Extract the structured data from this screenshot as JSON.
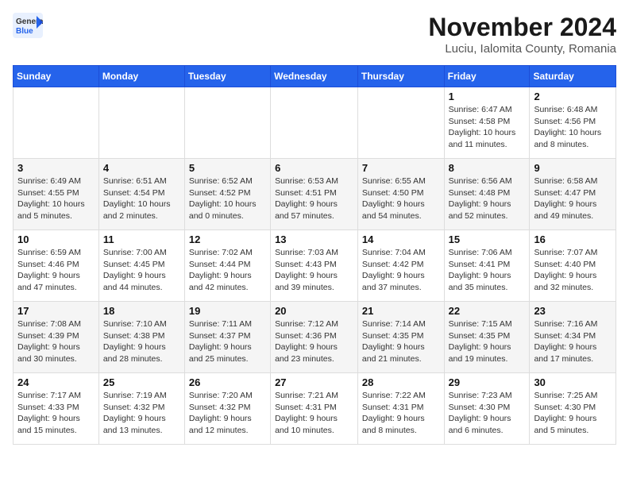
{
  "header": {
    "logo": {
      "line1": "General",
      "line2": "Blue"
    },
    "month": "November 2024",
    "location": "Luciu, Ialomita County, Romania"
  },
  "weekdays": [
    "Sunday",
    "Monday",
    "Tuesday",
    "Wednesday",
    "Thursday",
    "Friday",
    "Saturday"
  ],
  "weeks": [
    [
      {
        "day": "",
        "info": ""
      },
      {
        "day": "",
        "info": ""
      },
      {
        "day": "",
        "info": ""
      },
      {
        "day": "",
        "info": ""
      },
      {
        "day": "",
        "info": ""
      },
      {
        "day": "1",
        "info": "Sunrise: 6:47 AM\nSunset: 4:58 PM\nDaylight: 10 hours and 11 minutes."
      },
      {
        "day": "2",
        "info": "Sunrise: 6:48 AM\nSunset: 4:56 PM\nDaylight: 10 hours and 8 minutes."
      }
    ],
    [
      {
        "day": "3",
        "info": "Sunrise: 6:49 AM\nSunset: 4:55 PM\nDaylight: 10 hours and 5 minutes."
      },
      {
        "day": "4",
        "info": "Sunrise: 6:51 AM\nSunset: 4:54 PM\nDaylight: 10 hours and 2 minutes."
      },
      {
        "day": "5",
        "info": "Sunrise: 6:52 AM\nSunset: 4:52 PM\nDaylight: 10 hours and 0 minutes."
      },
      {
        "day": "6",
        "info": "Sunrise: 6:53 AM\nSunset: 4:51 PM\nDaylight: 9 hours and 57 minutes."
      },
      {
        "day": "7",
        "info": "Sunrise: 6:55 AM\nSunset: 4:50 PM\nDaylight: 9 hours and 54 minutes."
      },
      {
        "day": "8",
        "info": "Sunrise: 6:56 AM\nSunset: 4:48 PM\nDaylight: 9 hours and 52 minutes."
      },
      {
        "day": "9",
        "info": "Sunrise: 6:58 AM\nSunset: 4:47 PM\nDaylight: 9 hours and 49 minutes."
      }
    ],
    [
      {
        "day": "10",
        "info": "Sunrise: 6:59 AM\nSunset: 4:46 PM\nDaylight: 9 hours and 47 minutes."
      },
      {
        "day": "11",
        "info": "Sunrise: 7:00 AM\nSunset: 4:45 PM\nDaylight: 9 hours and 44 minutes."
      },
      {
        "day": "12",
        "info": "Sunrise: 7:02 AM\nSunset: 4:44 PM\nDaylight: 9 hours and 42 minutes."
      },
      {
        "day": "13",
        "info": "Sunrise: 7:03 AM\nSunset: 4:43 PM\nDaylight: 9 hours and 39 minutes."
      },
      {
        "day": "14",
        "info": "Sunrise: 7:04 AM\nSunset: 4:42 PM\nDaylight: 9 hours and 37 minutes."
      },
      {
        "day": "15",
        "info": "Sunrise: 7:06 AM\nSunset: 4:41 PM\nDaylight: 9 hours and 35 minutes."
      },
      {
        "day": "16",
        "info": "Sunrise: 7:07 AM\nSunset: 4:40 PM\nDaylight: 9 hours and 32 minutes."
      }
    ],
    [
      {
        "day": "17",
        "info": "Sunrise: 7:08 AM\nSunset: 4:39 PM\nDaylight: 9 hours and 30 minutes."
      },
      {
        "day": "18",
        "info": "Sunrise: 7:10 AM\nSunset: 4:38 PM\nDaylight: 9 hours and 28 minutes."
      },
      {
        "day": "19",
        "info": "Sunrise: 7:11 AM\nSunset: 4:37 PM\nDaylight: 9 hours and 25 minutes."
      },
      {
        "day": "20",
        "info": "Sunrise: 7:12 AM\nSunset: 4:36 PM\nDaylight: 9 hours and 23 minutes."
      },
      {
        "day": "21",
        "info": "Sunrise: 7:14 AM\nSunset: 4:35 PM\nDaylight: 9 hours and 21 minutes."
      },
      {
        "day": "22",
        "info": "Sunrise: 7:15 AM\nSunset: 4:35 PM\nDaylight: 9 hours and 19 minutes."
      },
      {
        "day": "23",
        "info": "Sunrise: 7:16 AM\nSunset: 4:34 PM\nDaylight: 9 hours and 17 minutes."
      }
    ],
    [
      {
        "day": "24",
        "info": "Sunrise: 7:17 AM\nSunset: 4:33 PM\nDaylight: 9 hours and 15 minutes."
      },
      {
        "day": "25",
        "info": "Sunrise: 7:19 AM\nSunset: 4:32 PM\nDaylight: 9 hours and 13 minutes."
      },
      {
        "day": "26",
        "info": "Sunrise: 7:20 AM\nSunset: 4:32 PM\nDaylight: 9 hours and 12 minutes."
      },
      {
        "day": "27",
        "info": "Sunrise: 7:21 AM\nSunset: 4:31 PM\nDaylight: 9 hours and 10 minutes."
      },
      {
        "day": "28",
        "info": "Sunrise: 7:22 AM\nSunset: 4:31 PM\nDaylight: 9 hours and 8 minutes."
      },
      {
        "day": "29",
        "info": "Sunrise: 7:23 AM\nSunset: 4:30 PM\nDaylight: 9 hours and 6 minutes."
      },
      {
        "day": "30",
        "info": "Sunrise: 7:25 AM\nSunset: 4:30 PM\nDaylight: 9 hours and 5 minutes."
      }
    ]
  ]
}
